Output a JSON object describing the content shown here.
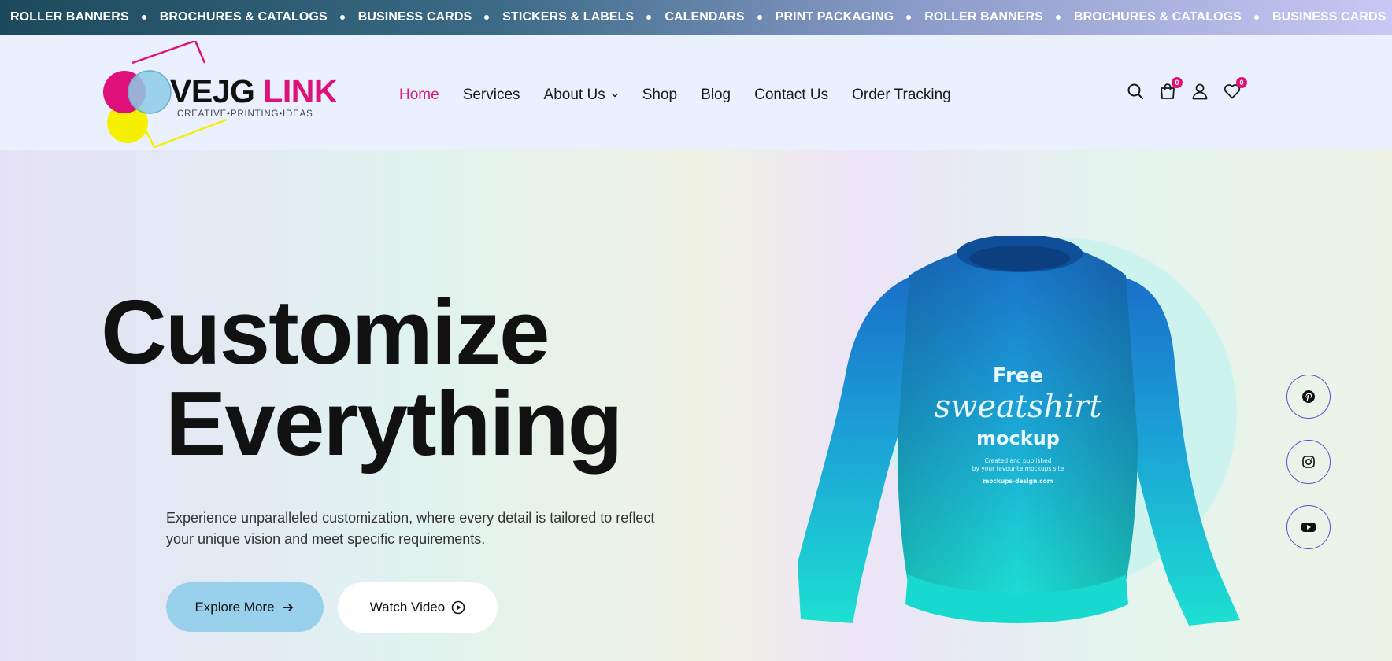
{
  "marquee": {
    "items": [
      "ROLLER BANNERS",
      "BROCHURES & CATALOGS",
      "BUSINESS CARDS",
      "STICKERS & LABELS",
      "CALENDARS",
      "PRINT PACKAGING",
      "ROLLER BANNERS",
      "BROCHURES & CATALOGS",
      "BUSINESS CARDS"
    ]
  },
  "brand": {
    "name_part1": "VEJG",
    "name_part2": "LINK",
    "tagline": "CREATIVE•PRINTING•IDEAS",
    "colors": {
      "magenta": "#e0107a",
      "cyan": "#8ecbe8",
      "yellow": "#f5f000"
    }
  },
  "nav": {
    "items": [
      {
        "label": "Home",
        "active": true
      },
      {
        "label": "Services",
        "active": false
      },
      {
        "label": "About Us",
        "active": false,
        "has_dropdown": true
      },
      {
        "label": "Shop",
        "active": false
      },
      {
        "label": "Blog",
        "active": false
      },
      {
        "label": "Contact Us",
        "active": false
      },
      {
        "label": "Order Tracking",
        "active": false
      }
    ],
    "active_color": "#d8197a"
  },
  "header_icons": {
    "search": "search-icon",
    "cart": {
      "icon": "shopping-bag-icon",
      "count": "0"
    },
    "account": "user-icon",
    "wishlist": {
      "icon": "heart-icon",
      "count": "0"
    }
  },
  "hero": {
    "line1": "Customize",
    "line2": "Everything",
    "description": "Experience unparalleled customization, where every detail is tailored to reflect your unique vision and meet specific requirements.",
    "primary_button": "Explore More",
    "secondary_button": "Watch Video"
  },
  "product_image": {
    "text_line1": "Free",
    "text_line2": "sweatshirt",
    "text_line3": "mockup",
    "text_small1": "Created and published",
    "text_small2": "by your favourite mockups site",
    "text_url": "mockups-design.com"
  },
  "socials": [
    {
      "name": "pinterest-icon"
    },
    {
      "name": "instagram-icon"
    },
    {
      "name": "youtube-icon"
    }
  ]
}
